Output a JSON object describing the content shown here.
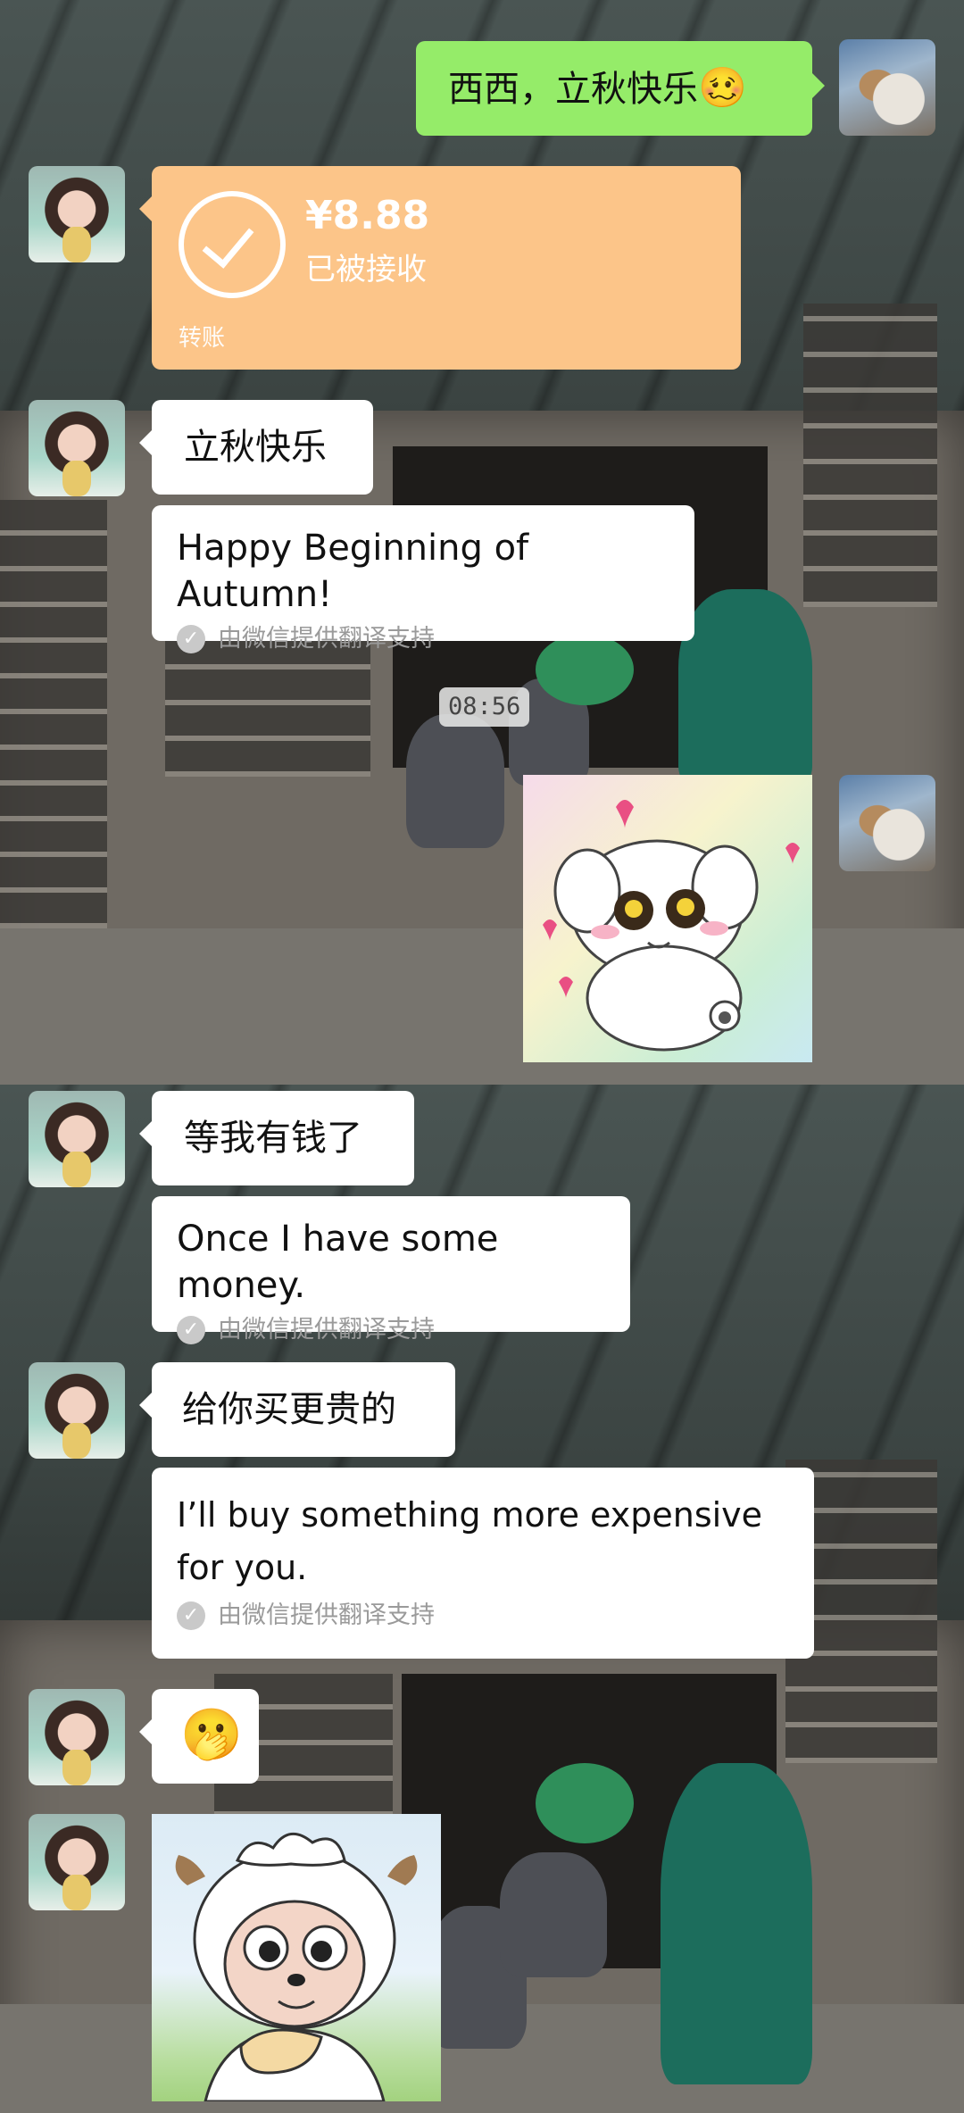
{
  "messages": {
    "m1": {
      "text": "西西，立秋快乐",
      "emoji": "🥴"
    },
    "transfer": {
      "amount": "¥8.88",
      "status": "已被接收",
      "kind": "转账"
    },
    "m3": {
      "text": "立秋快乐",
      "translation": "Happy Beginning of Autumn!",
      "translation_note": "由微信提供翻译支持"
    },
    "time": "08:56",
    "m5": {
      "text": "等我有钱了",
      "translation": "Once I have some money.",
      "translation_note": "由微信提供翻译支持"
    },
    "m6": {
      "text": "给你买更贵的",
      "translation_line1": "I’ll buy something more expensive",
      "translation_line2": "for you.",
      "translation_note": "由微信提供翻译支持"
    },
    "m7": {
      "emoji": "🫢"
    }
  },
  "icons": {
    "check": "check-circle-icon",
    "transfer": "transfer-done-icon"
  },
  "colors": {
    "bubble_self": "#95ec69",
    "bubble_other": "#ffffff",
    "transfer_card": "#fcc589"
  }
}
